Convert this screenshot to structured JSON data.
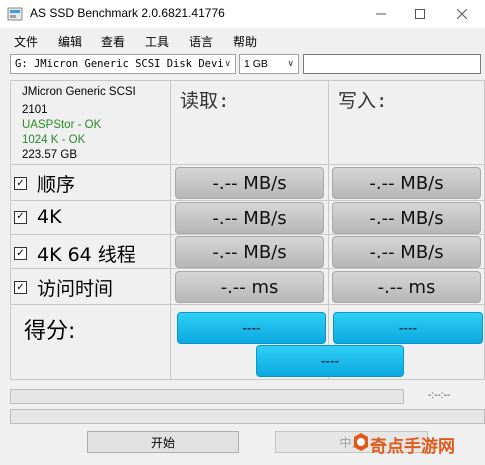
{
  "window": {
    "title": "AS SSD Benchmark 2.0.6821.41776",
    "min_icon": "minimize-icon",
    "max_icon": "maximize-icon",
    "close_icon": "close-icon"
  },
  "menu": [
    "文件",
    "编辑",
    "查看",
    "工具",
    "语言",
    "帮助"
  ],
  "toolbar": {
    "drive_select": "G: JMicron Generic SCSI Disk Devi",
    "size_select": "1 GB"
  },
  "device_info": {
    "name": "JMicron Generic SCSI",
    "firmware": "2101",
    "driver_status": "UASPStor - OK",
    "alignment_status": "1024 K - OK",
    "capacity": "223.57 GB"
  },
  "columns": {
    "read": "读取:",
    "write": "写入:"
  },
  "tests": [
    {
      "label": "顺序",
      "checked": true,
      "read": "-.-- MB/s",
      "write": "-.-- MB/s"
    },
    {
      "label": "4K",
      "checked": true,
      "read": "-.-- MB/s",
      "write": "-.-- MB/s"
    },
    {
      "label": "4K 64 线程",
      "checked": true,
      "read": "-.-- MB/s",
      "write": "-.-- MB/s"
    },
    {
      "label": "访问时间",
      "checked": true,
      "read": "-.-- ms",
      "write": "-.-- ms"
    }
  ],
  "score": {
    "label": "得分:",
    "read": "----",
    "write": "----",
    "total": "----"
  },
  "status": {
    "elapsed": "-:--:--"
  },
  "buttons": {
    "start": "开始",
    "stop": "中止"
  },
  "watermark": {
    "text": "奇点手游网"
  },
  "colors": {
    "score_bar": "#1ebde9",
    "status_ok": "#2a8a2a"
  }
}
